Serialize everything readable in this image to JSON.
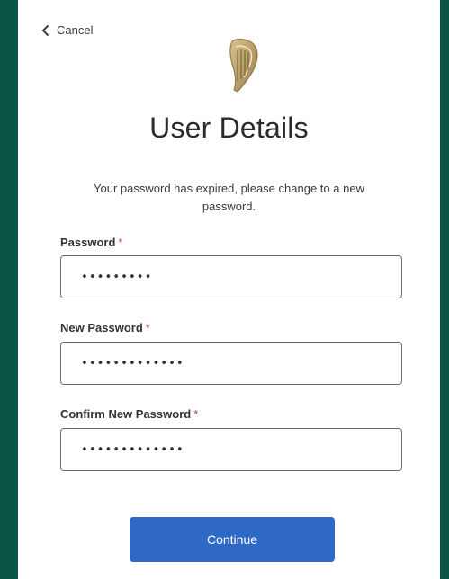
{
  "header": {
    "cancel_label": "Cancel",
    "logo_icon": "harp-icon"
  },
  "page": {
    "title": "User Details",
    "message": "Your password has expired, please change to a new password."
  },
  "form": {
    "fields": [
      {
        "label": "Password",
        "required_mark": "*",
        "value": "•••••••••"
      },
      {
        "label": "New Password",
        "required_mark": "*",
        "value": "•••••••••••••"
      },
      {
        "label": "Confirm New Password",
        "required_mark": "*",
        "value": "•••••••••••••"
      }
    ],
    "submit_label": "Continue"
  },
  "colors": {
    "frame": "#0b5446",
    "primary_button": "#2f69c7",
    "required": "#c0392b",
    "logo_gold": "#b8a06a"
  }
}
